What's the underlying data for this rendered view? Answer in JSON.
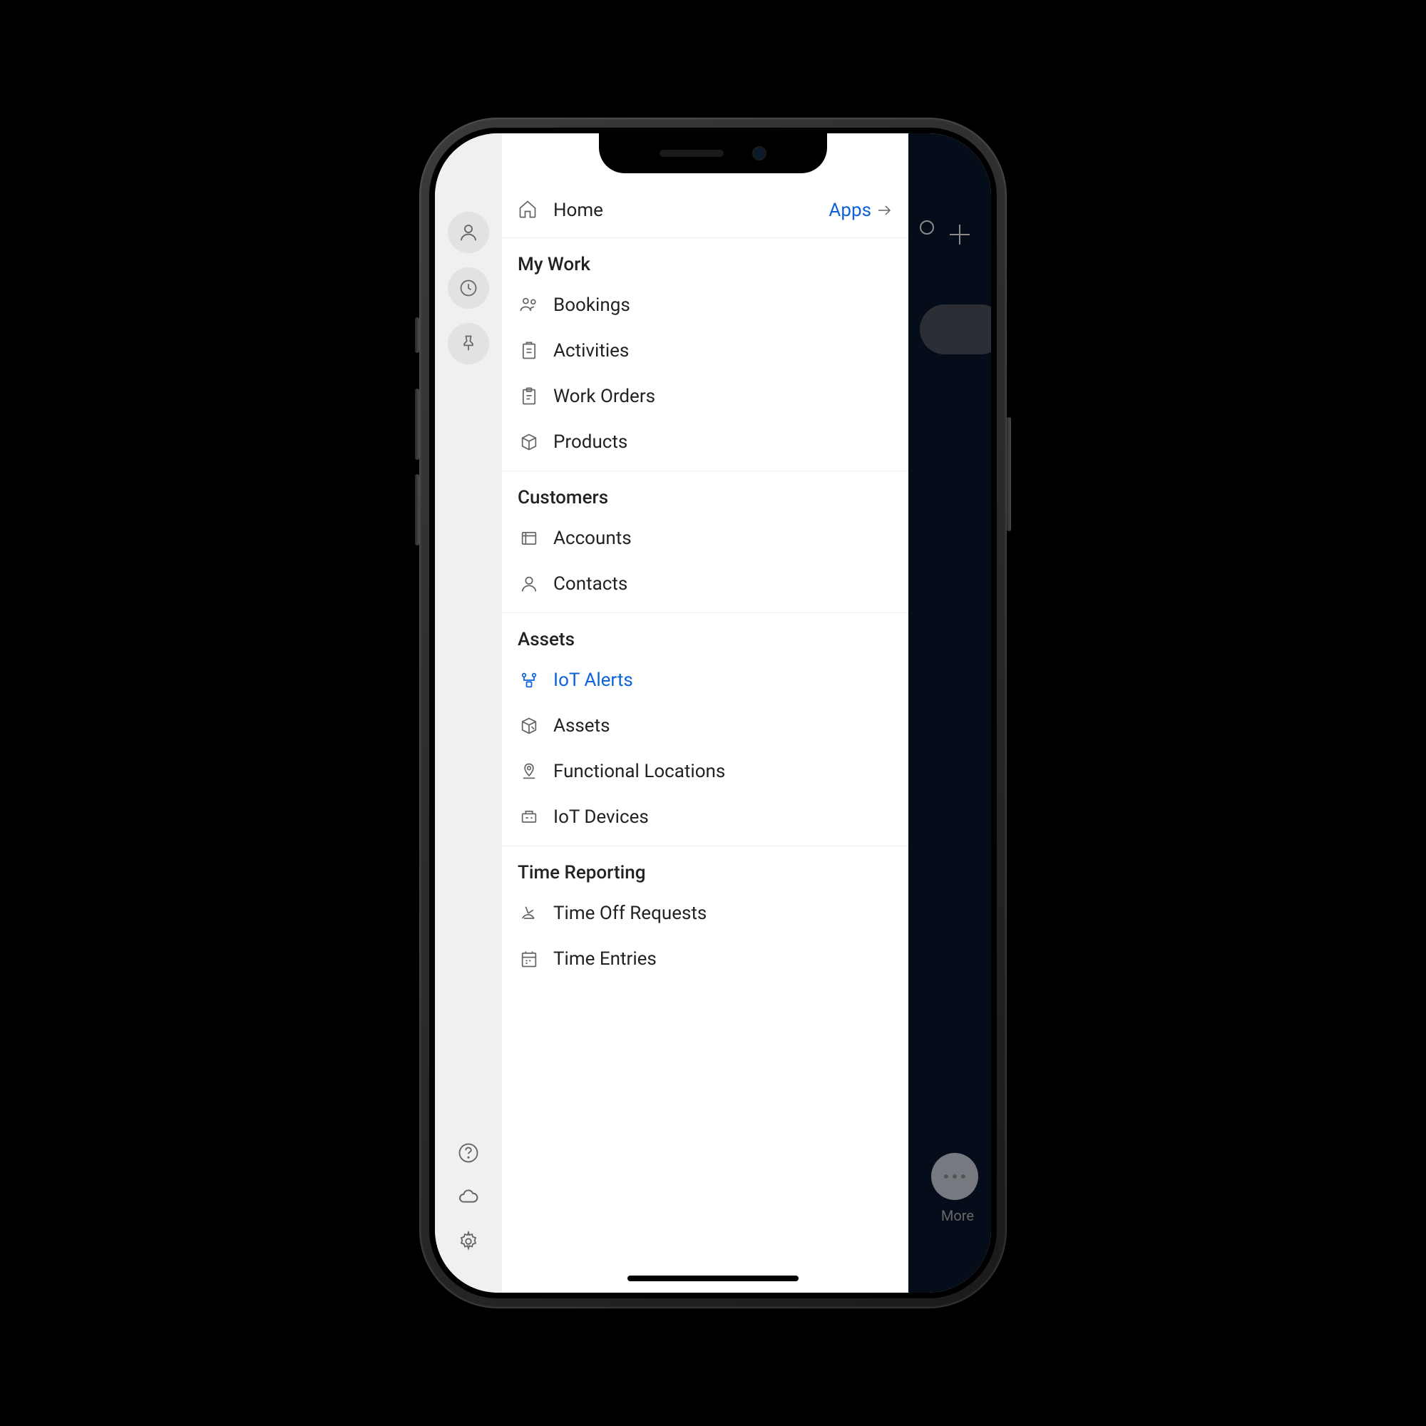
{
  "nav": {
    "home_label": "Home",
    "apps_label": "Apps",
    "sections": {
      "mywork": {
        "title": "My Work",
        "items": [
          {
            "label": "Bookings",
            "icon": "bookings-icon"
          },
          {
            "label": "Activities",
            "icon": "activities-icon"
          },
          {
            "label": "Work Orders",
            "icon": "work-orders-icon"
          },
          {
            "label": "Products",
            "icon": "products-icon"
          }
        ]
      },
      "customers": {
        "title": "Customers",
        "items": [
          {
            "label": "Accounts",
            "icon": "accounts-icon"
          },
          {
            "label": "Contacts",
            "icon": "contacts-icon"
          }
        ]
      },
      "assets": {
        "title": "Assets",
        "items": [
          {
            "label": "IoT Alerts",
            "icon": "iot-alerts-icon",
            "active": true
          },
          {
            "label": "Assets",
            "icon": "assets-icon"
          },
          {
            "label": "Functional Locations",
            "icon": "functional-locations-icon"
          },
          {
            "label": "IoT Devices",
            "icon": "iot-devices-icon"
          }
        ]
      },
      "time": {
        "title": "Time Reporting",
        "items": [
          {
            "label": "Time Off Requests",
            "icon": "time-off-icon"
          },
          {
            "label": "Time Entries",
            "icon": "time-entries-icon"
          }
        ]
      }
    }
  },
  "backdrop": {
    "more_label": "More"
  },
  "colors": {
    "accent": "#0b62da",
    "icon": "#666",
    "text": "#222"
  }
}
